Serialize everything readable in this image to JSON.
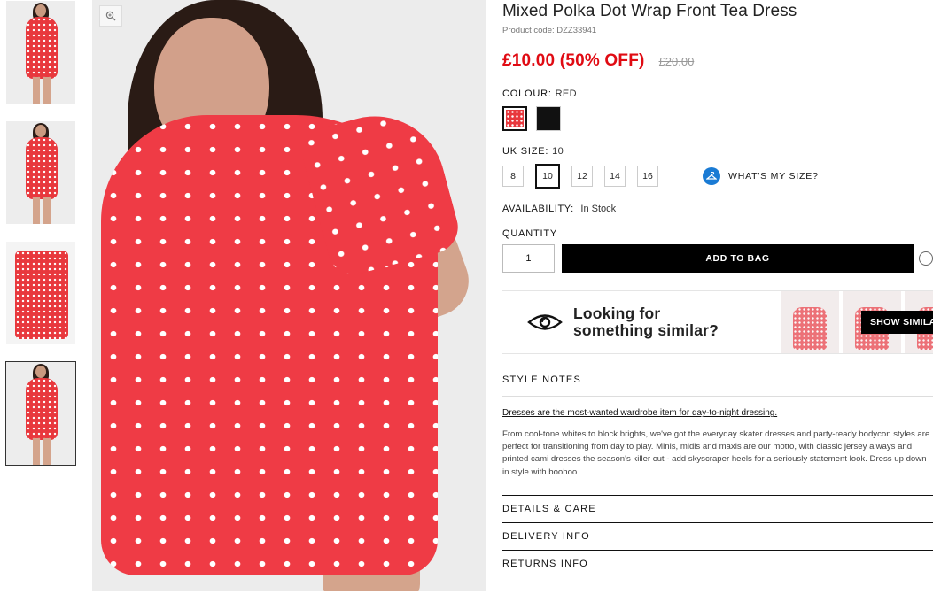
{
  "thumbnails": [
    {
      "alt": "model front view"
    },
    {
      "alt": "model side view"
    },
    {
      "alt": "dress flat lay"
    },
    {
      "alt": "model close view"
    }
  ],
  "main_image": {
    "zoom_icon": "zoom-in-icon"
  },
  "product": {
    "title": "Mixed Polka Dot Wrap Front Tea Dress",
    "code": "Product code: DZZ33941",
    "price": "£10.00 (50% OFF)",
    "old_price": "£20.00",
    "colour_label": "COLOUR:",
    "colour_value": "RED",
    "colours": [
      {
        "name": "red",
        "hex": "#e8383d"
      },
      {
        "name": "black",
        "hex": "#111111"
      }
    ],
    "size_label": "UK SIZE:",
    "size_value": "10",
    "sizes": [
      "8",
      "10",
      "12",
      "14",
      "16"
    ],
    "selected_size": "10",
    "whats_my_size": "WHAT'S MY SIZE?",
    "availability_label": "AVAILABILITY:",
    "availability_value": "In Stock",
    "quantity_label": "QUANTITY",
    "quantity_value": "1",
    "add_to_bag": "ADD TO BAG"
  },
  "similar": {
    "text_line1": "Looking for",
    "text_line2": "something similar?",
    "button": "SHOW SIMILA"
  },
  "style_notes": {
    "heading": "STYLE NOTES",
    "lead": "Dresses are the most-wanted wardrobe item for day-to-night dressing.",
    "body": "From cool-tone whites to block brights, we've got the everyday skater dresses and party-ready bodycon styles are perfect for transitioning from day to play. Minis, midis and maxis are our motto, with classic jersey always and printed cami dresses the season's killer cut - add skyscraper heels for a seriously statement look. Dress up down in style with boohoo."
  },
  "accordion": [
    "DETAILS & CARE",
    "DELIVERY INFO",
    "RETURNS INFO"
  ],
  "colors": {
    "sale_red": "#e00b13",
    "button_black": "#000000",
    "info_blue": "#1a7bd4"
  }
}
